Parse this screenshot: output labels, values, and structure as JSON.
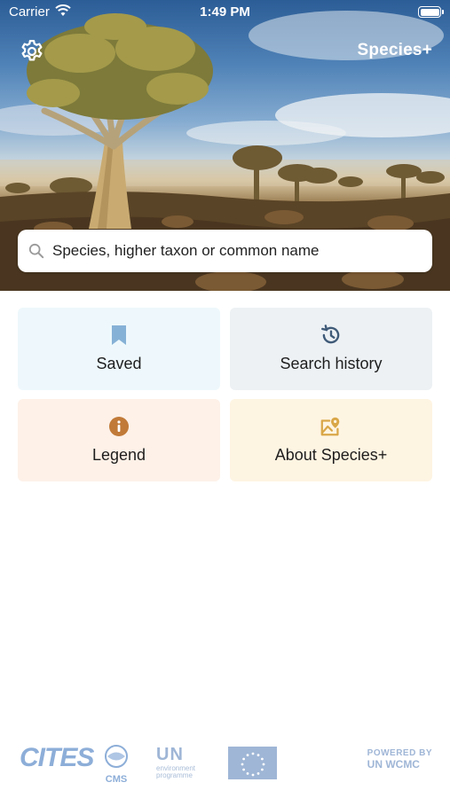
{
  "status_bar": {
    "carrier": "Carrier",
    "time": "1:49 PM"
  },
  "header": {
    "title": "Species+",
    "settings_icon": "gear-icon"
  },
  "search": {
    "placeholder": "Species, higher taxon or common name",
    "icon": "search-icon"
  },
  "tiles": [
    {
      "label": "Saved",
      "icon": "bookmark-icon",
      "background": "#eef8fc",
      "icon_color": "#86b1d6"
    },
    {
      "label": "Search history",
      "icon": "history-icon",
      "background": "#edf1f4",
      "icon_color": "#3f5a78"
    },
    {
      "label": "Legend",
      "icon": "info-icon",
      "background": "#fdf1e8",
      "icon_color": "#c17a38"
    },
    {
      "label": "About Species+",
      "icon": "map-pin-icon",
      "background": "#fef4e2",
      "icon_color": "#d9a647"
    }
  ],
  "footer": {
    "logos": {
      "cites": "CITES",
      "cms": "CMS",
      "un_main": "UN",
      "un_sub_1": "environment",
      "un_sub_2": "programme",
      "eu": "European Union flag",
      "wcmc_top": "POWERED BY",
      "wcmc_main": "UN WCMC"
    }
  }
}
